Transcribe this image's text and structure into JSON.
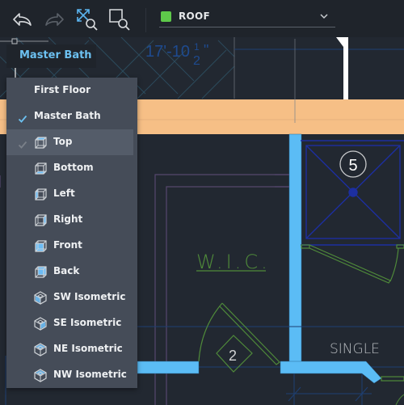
{
  "toolbar": {
    "undo": {
      "icon": "undo-icon",
      "enabled": true
    },
    "redo": {
      "icon": "redo-icon",
      "enabled": false
    },
    "zoom_extents": {
      "icon": "zoom-extents-icon"
    },
    "zoom_window": {
      "icon": "zoom-window-icon"
    },
    "layer": {
      "name": "ROOF",
      "color": "#5ec94a"
    }
  },
  "view_tag": {
    "label": "Master Bath"
  },
  "drawing": {
    "dimension_text": "17'-10",
    "dimension_fraction_num": "1",
    "dimension_fraction_den": "2",
    "dimension_inch": "\"",
    "room_label": "W.I.C.",
    "door_tag": "2",
    "fixture_tag": "5",
    "bed_label": "SINGLE",
    "colors": {
      "wall": "#5bbcf5",
      "beam": "#f6bf86",
      "hatch": "#2c4a5c",
      "grid": "#1e3f72",
      "green": "#4f8a3a",
      "purple": "#56476e",
      "blue": "#1d2fa0"
    }
  },
  "menu": {
    "items": [
      {
        "label": "First Floor",
        "checked": false,
        "icon": null
      },
      {
        "label": "Master Bath",
        "checked": true,
        "icon": null
      },
      {
        "label": "Top",
        "checked": true,
        "dim_check": true,
        "hover": true,
        "icon": "view-top-icon"
      },
      {
        "label": "Bottom",
        "checked": false,
        "icon": "view-bottom-icon"
      },
      {
        "label": "Left",
        "checked": false,
        "icon": "view-left-icon"
      },
      {
        "label": "Right",
        "checked": false,
        "icon": "view-right-icon"
      },
      {
        "label": "Front",
        "checked": false,
        "icon": "view-front-icon"
      },
      {
        "label": "Back",
        "checked": false,
        "icon": "view-back-icon"
      },
      {
        "label": "SW Isometric",
        "checked": false,
        "icon": "sw-isometric-icon"
      },
      {
        "label": "SE Isometric",
        "checked": false,
        "icon": "se-isometric-icon"
      },
      {
        "label": "NE Isometric",
        "checked": false,
        "icon": "ne-isometric-icon"
      },
      {
        "label": "NW Isometric",
        "checked": false,
        "icon": "nw-isometric-icon"
      }
    ]
  }
}
